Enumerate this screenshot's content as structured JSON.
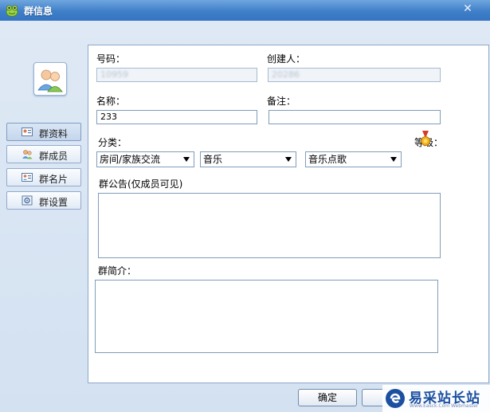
{
  "window": {
    "title": "群信息",
    "close_glyph": "✕"
  },
  "sidebar": {
    "items": [
      {
        "label": "群资料",
        "icon": "profile-card-icon",
        "active": true
      },
      {
        "label": "群成员",
        "icon": "members-icon",
        "active": false
      },
      {
        "label": "群名片",
        "icon": "name-card-icon",
        "active": false
      },
      {
        "label": "群设置",
        "icon": "settings-icon",
        "active": false
      }
    ]
  },
  "form": {
    "number_label": "号码：",
    "number_value": "10959",
    "creator_label": "创建人：",
    "creator_value": "20286",
    "name_label": "名称：",
    "name_value": "233",
    "note_label": "备注：",
    "note_value": "",
    "category_label": "分类：",
    "category_1": "房间/家族交流",
    "category_2": "音乐",
    "category_3": "音乐点歌",
    "level_label": "等级：",
    "announcement_label": "群公告(仅成员可见)",
    "intro_label": "群简介："
  },
  "footer": {
    "ok_label": "确定"
  },
  "watermark": {
    "text": "易采站长站",
    "sub": "Www.Easck.Com Webmaster"
  },
  "colors": {
    "title_bar": "#3f7fc8",
    "panel_border": "#8ea8c9",
    "accent": "#1b4fa0"
  }
}
